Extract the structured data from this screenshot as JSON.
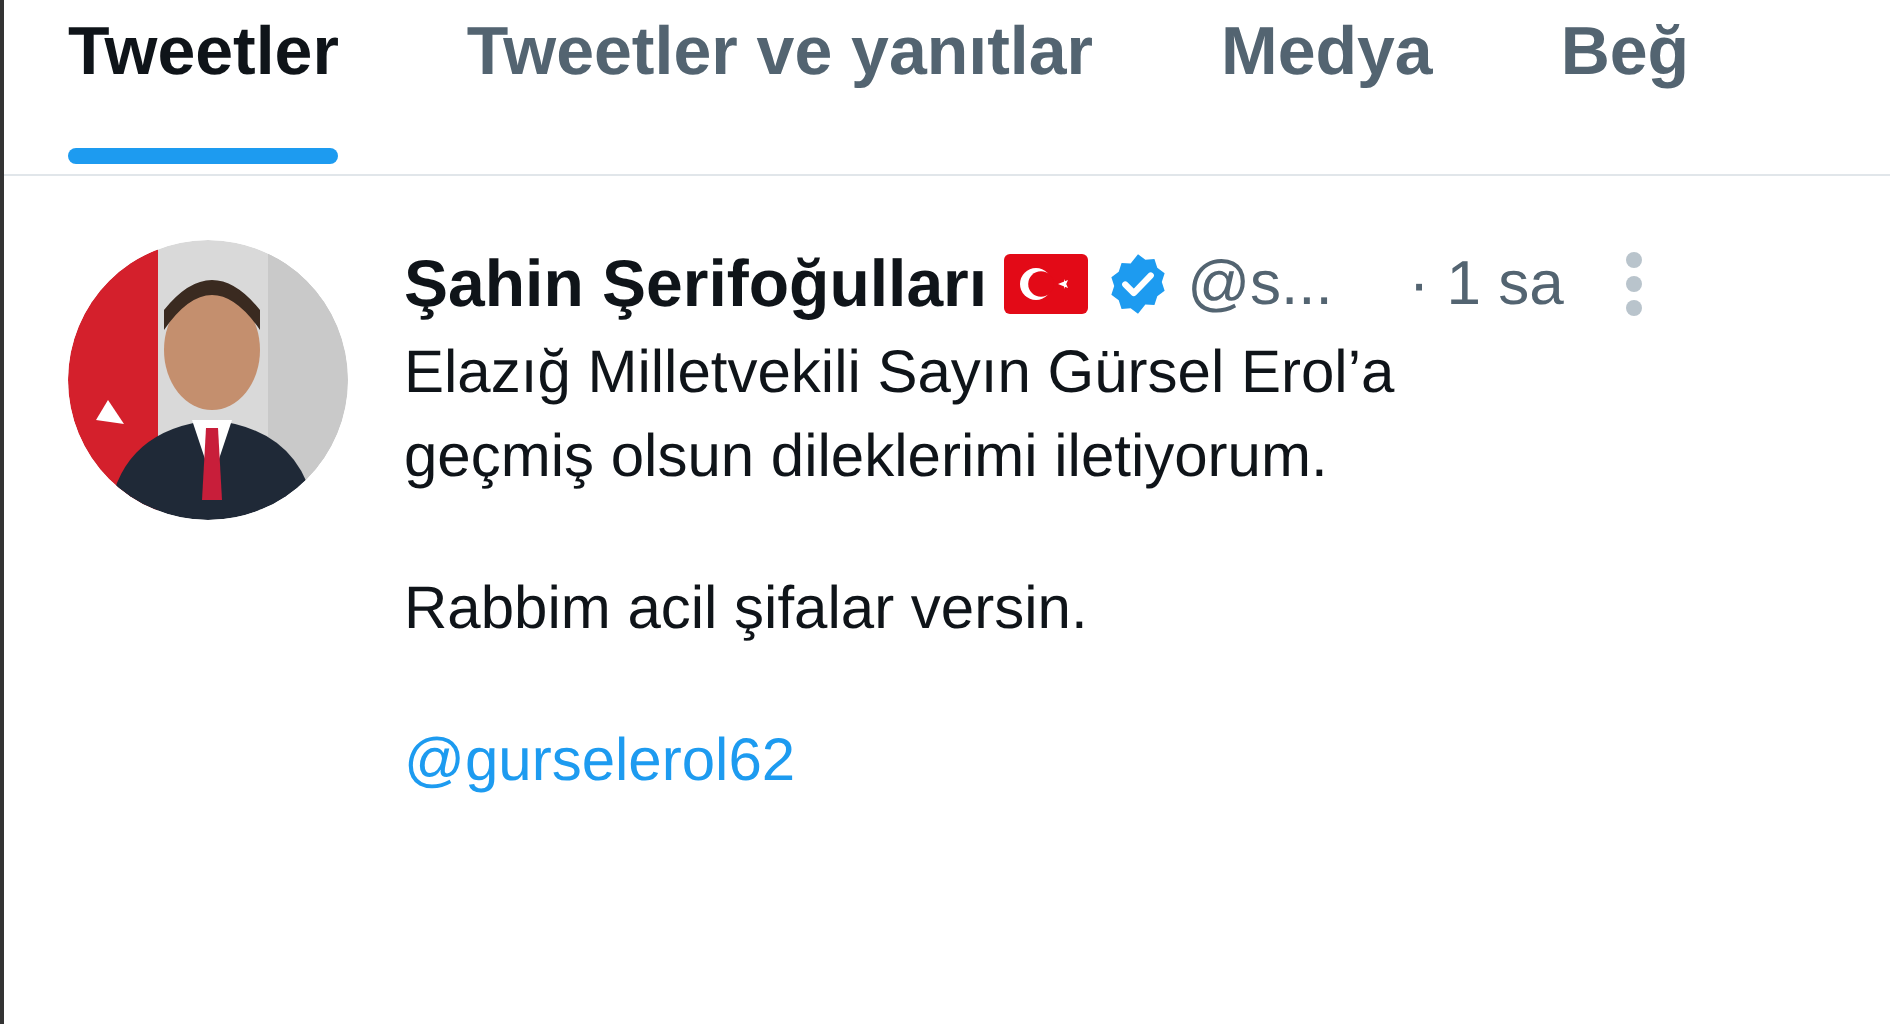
{
  "tabs": [
    {
      "label": "Tweetler",
      "selected": true
    },
    {
      "label": "Tweetler ve yanıtlar",
      "selected": false
    },
    {
      "label": "Medya",
      "selected": false
    },
    {
      "label": "Beğ",
      "selected": false
    }
  ],
  "tweet": {
    "author": "Şahin Şerifoğulları",
    "verified": true,
    "handle": "@s...",
    "time": "· 1 sa",
    "paragraphs": [
      {
        "kind": "text",
        "text": "Elazığ Milletvekili Sayın Gürsel Erol’a\ngeçmiş olsun dileklerimi iletiyorum."
      },
      {
        "kind": "text",
        "text": "Rabbim acil şifalar versin."
      },
      {
        "kind": "mention",
        "text": "@gurselerol62"
      }
    ]
  }
}
